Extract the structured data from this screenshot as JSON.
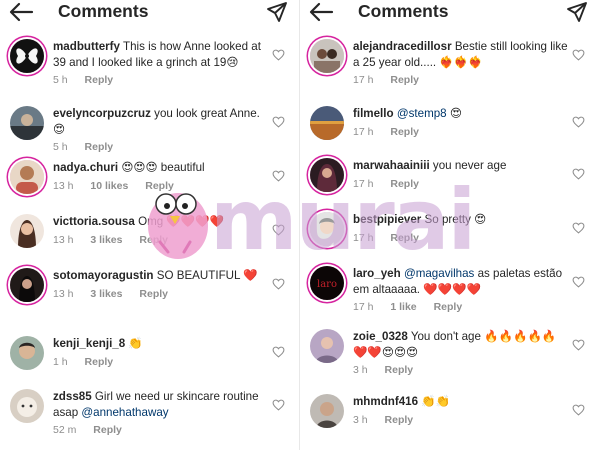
{
  "left": {
    "title": "Comments",
    "comments": [
      {
        "username": "madbutterfy",
        "text": "This is how Anne looked at 39 and I looked like a grinch at 19😢",
        "time": "5 h",
        "likes": "",
        "reply": "Reply"
      },
      {
        "username": "evelyncorpuzcruz",
        "text": "you look great Anne. 😍",
        "time": "5 h",
        "likes": "",
        "reply": "Reply"
      },
      {
        "username": "nadya.churi",
        "text": "😍😍😍 beautiful",
        "time": "13 h",
        "likes": "10 likes",
        "reply": "Reply"
      },
      {
        "username": "victtoria.sousa",
        "text": "Omg ❤️❤️❤️❤️",
        "time": "13 h",
        "likes": "3 likes",
        "reply": "Reply"
      },
      {
        "username": "sotomayoragustin",
        "text": "SO BEAUTIFUL ❤️",
        "time": "13 h",
        "likes": "3 likes",
        "reply": "Reply"
      },
      {
        "username": "kenji_kenji_8",
        "text": "👏",
        "time": "1 h",
        "likes": "",
        "reply": "Reply"
      },
      {
        "username": "zdss85",
        "text": "Girl we need ur skincare routine asap",
        "mention": "@annehathaway",
        "time": "52 m",
        "likes": "",
        "reply": "Reply"
      }
    ]
  },
  "right": {
    "title": "Comments",
    "comments": [
      {
        "username": "alejandracedillosr",
        "text": "Bestie still looking like a 25 year old..... ❤️‍🔥❤️‍🔥❤️‍🔥",
        "time": "17 h",
        "likes": "",
        "reply": "Reply"
      },
      {
        "username": "filmello",
        "mention": "@stemp8",
        "text": "😍",
        "time": "17 h",
        "likes": "",
        "reply": "Reply"
      },
      {
        "username": "marwahaainiii",
        "text": "you never age",
        "time": "17 h",
        "likes": "",
        "reply": "Reply"
      },
      {
        "username": "bestpipiever",
        "text": "So pretty 😍",
        "time": "17 h",
        "likes": "",
        "reply": "Reply"
      },
      {
        "username": "laro_yeh",
        "mention": "@magavilhas",
        "text": "as paletas estão em altaaaaa. ❤️❤️❤️❤️",
        "time": "17 h",
        "likes": "1 like",
        "reply": "Reply"
      },
      {
        "username": "zoie_0328",
        "text": "You don't age 🔥🔥🔥🔥🔥 ❤️❤️😍😍😍",
        "time": "3 h",
        "likes": "",
        "reply": "Reply"
      },
      {
        "username": "mhmdnf416",
        "text": "👏👏",
        "time": "3 h",
        "likes": "",
        "reply": "Reply"
      }
    ]
  },
  "watermark": "murai",
  "colors": {
    "mention": "#00376b",
    "meta": "#8e8e8e",
    "story_ring": "#d6249f",
    "watermark": "#c8a0d2"
  },
  "icons": {
    "back": "arrow-left-icon",
    "share": "paper-plane-icon",
    "like": "heart-outline-icon"
  }
}
